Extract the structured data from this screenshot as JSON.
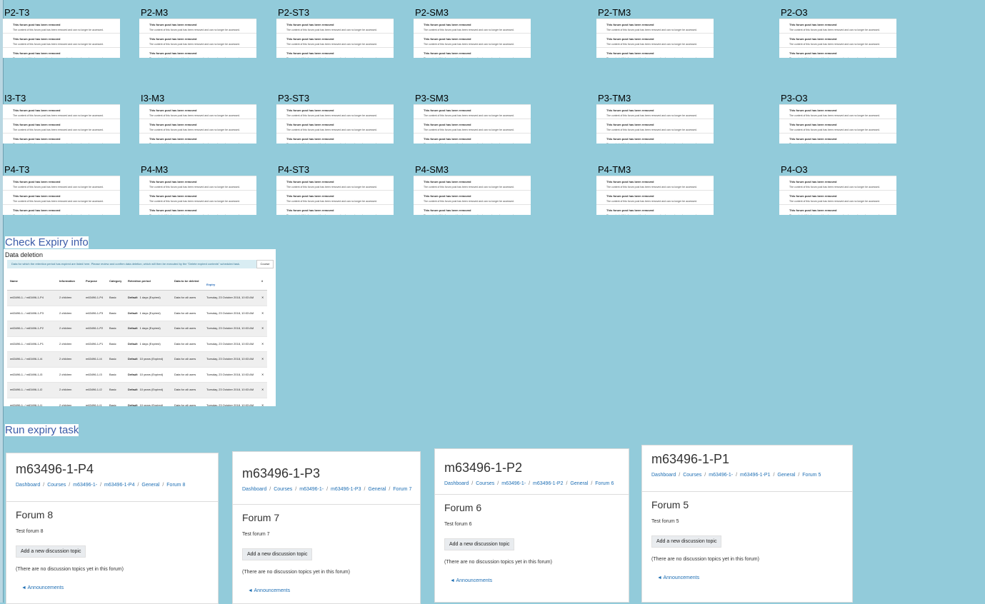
{
  "grid": {
    "labels": [
      [
        "P2-T3",
        "P2-M3",
        "P2-ST3",
        "P2-SM3",
        "P2-TM3",
        "P2-O3"
      ],
      [
        "I3-T3",
        "I3-M3",
        "P3-ST3",
        "P3-SM3",
        "P3-TM3",
        "P3-O3"
      ],
      [
        "P4-T3",
        "P4-M3",
        "P4-ST3",
        "P4-SM3",
        "P4-TM3",
        "P4-O3"
      ]
    ],
    "post_title": "This forum post has been removed",
    "post_body": "The content of this forum post has been removed and can no longer be accessed."
  },
  "sections": {
    "check": "Check Expiry info",
    "run": "Run expiry task"
  },
  "data_deletion": {
    "title": "Data deletion",
    "info": "Data for which the retention period has expired are listed here. Please review and confirm data deletion, which will then be executed by the \"Delete expired contexts\" scheduled task.",
    "course_button": "Course",
    "headers": [
      "Name",
      "Information",
      "Purpose",
      "Category",
      "Retention period",
      "Data to be deleted",
      "Expiry",
      "#"
    ],
    "rows": [
      {
        "name": "m63496-1- / m63496-1-P4",
        "info": "2 children",
        "purpose": "m63496-1-P4",
        "category": "Basic",
        "retention_label": "Default",
        "retention": "1 days (Expired)",
        "data": "Data for all users",
        "expiry": "Tuesday, 23 October 2018, 10:03 AM"
      },
      {
        "name": "m63496-1- / m63496-1-P3",
        "info": "2 children",
        "purpose": "m63496-1-P3",
        "category": "Basic",
        "retention_label": "Default",
        "retention": "1 days (Expired)",
        "data": "Data for all users",
        "expiry": "Tuesday, 23 October 2018, 10:03 AM"
      },
      {
        "name": "m63496-1- / m63496-1-P2",
        "info": "2 children",
        "purpose": "m63496-1-P2",
        "category": "Basic",
        "retention_label": "Default",
        "retention": "1 days (Expired)",
        "data": "Data for all users",
        "expiry": "Tuesday, 23 October 2018, 10:03 AM"
      },
      {
        "name": "m63496-1- / m63496-1-P1",
        "info": "2 children",
        "purpose": "m63496-1-P1",
        "category": "Basic",
        "retention_label": "Default",
        "retention": "1 days (Expired)",
        "data": "Data for all users",
        "expiry": "Tuesday, 23 October 2018, 10:03 AM"
      },
      {
        "name": "m63496-1- / m63496-1-I4",
        "info": "2 children",
        "purpose": "m63496-1-I4",
        "category": "Basic",
        "retention_label": "Default",
        "retention": "10 years (Expired)",
        "data": "Data for all users",
        "expiry": "Tuesday, 23 October 2018, 10:03 AM"
      },
      {
        "name": "m63496-1- / m63496-1-I3",
        "info": "2 children",
        "purpose": "m63496-1-I3",
        "category": "Basic",
        "retention_label": "Default",
        "retention": "10 years (Expired)",
        "data": "Data for all users",
        "expiry": "Tuesday, 23 October 2018, 10:03 AM"
      },
      {
        "name": "m63496-1- / m63496-1-I2",
        "info": "2 children",
        "purpose": "m63496-1-I2",
        "category": "Basic",
        "retention_label": "Default",
        "retention": "10 years (Expired)",
        "data": "Data for all users",
        "expiry": "Tuesday, 23 October 2018, 10:03 AM"
      },
      {
        "name": "m63496-1- / m63496-1-I1",
        "info": "2 children",
        "purpose": "m63496-1-I1",
        "category": "Basic",
        "retention_label": "Default",
        "retention": "10 years (Expired)",
        "data": "Data for all users",
        "expiry": "Tuesday, 23 October 2018, 10:03 AM"
      }
    ]
  },
  "forums": [
    {
      "course": "m63496-1-P4",
      "crumbs": [
        "Dashboard",
        "Courses",
        "m63496-1-",
        "m63496-1-P4",
        "General",
        "Forum 8"
      ],
      "title": "Forum 8",
      "desc": "Test forum 8",
      "add": "Add a new discussion topic",
      "none": "(There are no discussion topics yet in this forum)",
      "ann": "◄ Announcements"
    },
    {
      "course": "m63496-1-P3",
      "crumbs": [
        "Dashboard",
        "Courses",
        "m63496-1-",
        "m63496-1-P3",
        "General",
        "Forum 7"
      ],
      "title": "Forum 7",
      "desc": "Test forum 7",
      "add": "Add a new discussion topic",
      "none": "(There are no discussion topics yet in this forum)",
      "ann": "◄ Announcements"
    },
    {
      "course": "m63496-1-P2",
      "crumbs": [
        "Dashboard",
        "Courses",
        "m63496-1-",
        "m63496-1-P2",
        "General",
        "Forum 6"
      ],
      "title": "Forum 6",
      "desc": "Test forum 6",
      "add": "Add a new discussion topic",
      "none": "(There are no discussion topics yet in this forum)",
      "ann": "◄ Announcements"
    },
    {
      "course": "m63496-1-P1",
      "crumbs": [
        "Dashboard",
        "Courses",
        "m63496-1-",
        "m63496-1-P1",
        "General",
        "Forum 5"
      ],
      "title": "Forum 5",
      "desc": "Test forum 5",
      "add": "Add a new discussion topic",
      "none": "(There are no discussion topics yet in this forum)",
      "ann": "◄ Announcements"
    }
  ]
}
